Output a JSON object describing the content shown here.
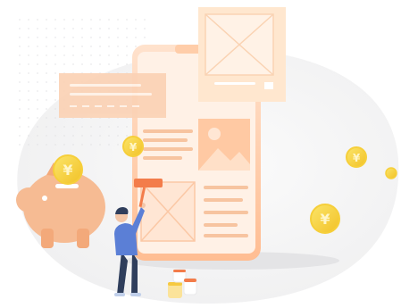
{
  "illustration": {
    "coin_symbol": "¥",
    "colors": {
      "accent_orange": "#F7A56E",
      "phone_body": "#FFD7BC",
      "phone_screen": "#FFF3EA",
      "coin_gold": "#F7D63E",
      "piggy_bank": "#F6BB93",
      "person_shirt": "#5B7FD6",
      "person_pants": "#2F3E5C",
      "background_blob": "#F3F3F4"
    }
  }
}
